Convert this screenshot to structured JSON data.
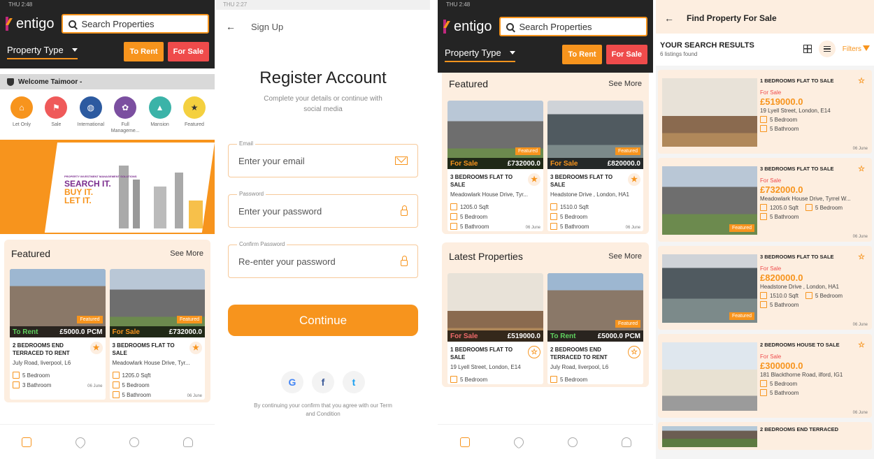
{
  "s1": {
    "status": "THU 2:48",
    "logo": "entigo",
    "search_placeholder": "Search Properties",
    "property_type": "Property Type",
    "to_rent": "To Rent",
    "for_sale": "For Sale",
    "welcome": "Welcome Taimoor -",
    "categories": [
      {
        "label": "Let Only",
        "icon": "rent-sign-icon"
      },
      {
        "label": "Sale",
        "icon": "sale-sign-icon"
      },
      {
        "label": "International",
        "icon": "globe-icon"
      },
      {
        "label": "Full Manageme...",
        "icon": "management-icon"
      },
      {
        "label": "Mansion",
        "icon": "mansion-icon"
      },
      {
        "label": "Featured",
        "icon": "star-icon"
      }
    ],
    "banner": {
      "small": "PROPERTY INVESTMENT MANAGEMENT SOLUTIONS",
      "l1": "SEARCH IT.",
      "l2": "BUY IT.",
      "l3": "LET IT."
    },
    "featured_title": "Featured",
    "see_more": "See More",
    "cards": [
      {
        "tag": "To Rent",
        "price": "£5000.0 PCM",
        "badge": "Featured",
        "title": "2 BEDROOMS END TERRACED TO RENT",
        "address": "July Road, liverpool, L6",
        "bed": "5 Bedroom",
        "bath": "3 Bathroom",
        "date": "06 June"
      },
      {
        "tag": "For Sale",
        "price": "£732000.0",
        "badge": "Featured",
        "title": "3 BEDROOMS FLAT TO SALE",
        "address": "Meadowlark House Drive, Tyr...",
        "sqft": "1205.0 Sqft",
        "bed": "5 Bedroom",
        "bath": "5 Bathroom",
        "date": "06 June"
      }
    ]
  },
  "s2": {
    "status": "THU 2:27",
    "header": "Sign Up",
    "title": "Register Account",
    "subtitle": "Complete your details or continue with social media",
    "email_label": "Email",
    "email_placeholder": "Enter your email",
    "password_label": "Password",
    "password_placeholder": "Enter your password",
    "confirm_label": "Confirm Password",
    "confirm_placeholder": "Re-enter your password",
    "continue": "Continue",
    "google": "G",
    "facebook": "f",
    "twitter": "t",
    "terms": "By continuing your confirm that you agree with our Term and Condition"
  },
  "s3": {
    "status": "THU 2:48",
    "logo": "entigo",
    "search_placeholder": "Search Properties",
    "property_type": "Property Type",
    "to_rent": "To Rent",
    "for_sale": "For Sale",
    "featured_title": "Featured",
    "see_more": "See More",
    "featured": [
      {
        "tag": "For Sale",
        "price": "£732000.0",
        "badge": "Featured",
        "title": "3 BEDROOMS FLAT TO SALE",
        "address": "Meadowlark House Drive, Tyr...",
        "sqft": "1205.0 Sqft",
        "bed": "5 Bedroom",
        "bath": "5 Bathroom",
        "date": "06 June"
      },
      {
        "tag": "For Sale",
        "price": "£820000.0",
        "badge": "Featured",
        "title": "3 BEDROOMS FLAT TO SALE",
        "address": "Headstone Drive , London, HA1",
        "sqft": "1510.0 Sqft",
        "bed": "5 Bedroom",
        "bath": "5 Bathroom",
        "date": "06 June"
      }
    ],
    "latest_title": "Latest Properties",
    "latest": [
      {
        "tag": "For Sale",
        "price": "£519000.0",
        "title": "1 BEDROOMS FLAT TO SALE",
        "address": "19 Lyell Street, London, E14",
        "bed": "5 Bedroom"
      },
      {
        "tag": "To Rent",
        "price": "£5000.0 PCM",
        "badge": "Featured",
        "title": "2 BEDROOMS END TERRACED TO RENT",
        "address": "July Road, liverpool, L6",
        "bed": "5 Bedroom"
      }
    ]
  },
  "s4": {
    "header": "Find Property For Sale",
    "results_title": "YOUR SEARCH RESULTS",
    "results_count": "6 listings found",
    "filters": "Filters",
    "listings": [
      {
        "title": "1 BEDROOMS FLAT TO SALE",
        "status": "For Sale",
        "price": "£519000.0",
        "address": "19 Lyell Street, London, E14",
        "bed": "5 Bedroom",
        "bath": "5 Bathroom",
        "date": "06 June"
      },
      {
        "title": "3 BEDROOMS FLAT TO SALE",
        "status": "For Sale",
        "price": "£732000.0",
        "address": "Meadowlark House Drive, Tyrrel W...",
        "sqft": "1205.0 Sqft",
        "bed": "5 Bedroom",
        "bath": "5 Bathroom",
        "date": "06 June",
        "badge": "Featured"
      },
      {
        "title": "3 BEDROOMS FLAT TO SALE",
        "status": "For Sale",
        "price": "£820000.0",
        "address": "Headstone Drive , London, HA1",
        "sqft": "1510.0 Sqft",
        "bed": "5 Bedroom",
        "bath": "5 Bathroom",
        "date": "06 June",
        "badge": "Featured"
      },
      {
        "title": "2 BEDROOMS HOUSE TO SALE",
        "status": "For Sale",
        "price": "£300000.0",
        "address": "181 Blackthorne Road, ilford, IG1",
        "bed": "5 Bedroom",
        "bath": "5 Bathroom",
        "date": "06 June"
      },
      {
        "title": "2 BEDROOMS END TERRACED"
      }
    ]
  }
}
